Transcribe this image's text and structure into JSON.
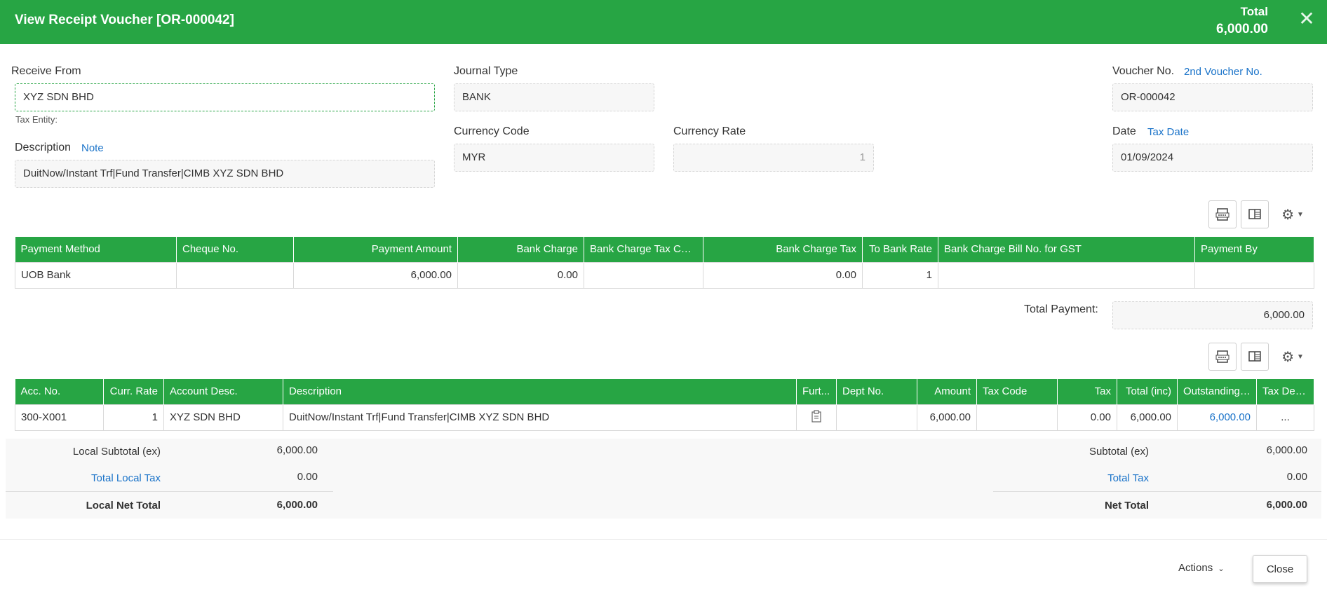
{
  "header": {
    "title": "View Receipt Voucher [OR-000042]",
    "total_label": "Total",
    "total_value": "6,000.00"
  },
  "form": {
    "receive_from_label": "Receive From",
    "receive_from_value": "XYZ SDN BHD",
    "tax_entity_label": "Tax Entity:",
    "description_label": "Description",
    "note_link": "Note",
    "description_value": "DuitNow/Instant Trf|Fund Transfer|CIMB XYZ SDN BHD",
    "journal_type_label": "Journal Type",
    "journal_type_value": "BANK",
    "currency_code_label": "Currency Code",
    "currency_code_value": "MYR",
    "currency_rate_label": "Currency Rate",
    "currency_rate_value": "1",
    "voucher_no_label": "Voucher No.",
    "second_voucher_link": "2nd Voucher No.",
    "voucher_no_value": "OR-000042",
    "date_label": "Date",
    "tax_date_link": "Tax Date",
    "date_value": "01/09/2024"
  },
  "payment_table": {
    "headers": [
      "Payment Method",
      "Cheque No.",
      "Payment Amount",
      "Bank Charge",
      "Bank Charge Tax Code",
      "Bank Charge Tax",
      "To Bank Rate",
      "Bank Charge Bill No. for GST",
      "Payment By"
    ],
    "row": [
      "UOB Bank",
      "",
      "6,000.00",
      "0.00",
      "",
      "0.00",
      "1",
      "",
      ""
    ]
  },
  "total_payment": {
    "label": "Total Payment:",
    "value": "6,000.00"
  },
  "detail_table": {
    "headers": [
      "Acc. No.",
      "Curr. Rate",
      "Account Desc.",
      "Description",
      "Furt...",
      "Dept No.",
      "Amount",
      "Tax Code",
      "Tax",
      "Total (inc)",
      "Outstanding ...",
      "Tax Detail"
    ],
    "row": [
      "300-X001",
      "1",
      "XYZ SDN BHD",
      "DuitNow/Instant Trf|Fund Transfer|CIMB XYZ SDN BHD",
      "",
      "",
      "6,000.00",
      "",
      "0.00",
      "6,000.00",
      "6,000.00",
      "..."
    ]
  },
  "local_totals": {
    "subtotal_label": "Local Subtotal (ex)",
    "subtotal_value": "6,000.00",
    "tax_label": "Total Local Tax",
    "tax_value": "0.00",
    "net_label": "Local Net Total",
    "net_value": "6,000.00"
  },
  "totals": {
    "subtotal_label": "Subtotal (ex)",
    "subtotal_value": "6,000.00",
    "tax_label": "Total Tax",
    "tax_value": "0.00",
    "net_label": "Net Total",
    "net_value": "6,000.00"
  },
  "footer": {
    "actions_label": "Actions",
    "close_label": "Close"
  },
  "colors": {
    "accent": "#27a544",
    "link": "#1a73c9"
  },
  "icons": [
    "close-icon",
    "xlsx-export-icon",
    "column-chooser-icon",
    "gear-icon",
    "chevron-down-icon",
    "clipboard-icon"
  ]
}
